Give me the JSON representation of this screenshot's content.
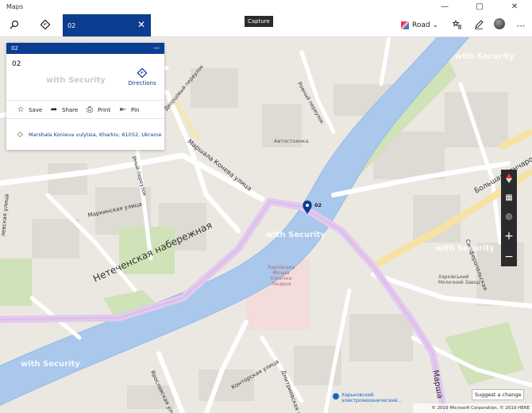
{
  "titlebar": {
    "app_title": "Maps",
    "minimize_icon": "minimize-icon",
    "maximize_icon": "maximize-icon",
    "close_icon": "close-icon"
  },
  "toolbar": {
    "search_icon": "search-icon",
    "directions_icon": "directions-icon",
    "search_value": "02",
    "clear_icon": "close-icon",
    "capture_tooltip": "Capture",
    "road_label": "Road",
    "accent_color": "#0b3d91"
  },
  "panel": {
    "header_title": "02",
    "title": "02",
    "directions_label": "Directions",
    "actions": [
      {
        "label": "Save",
        "icon": "star-icon"
      },
      {
        "label": "Share",
        "icon": "share-icon"
      },
      {
        "label": "Print",
        "icon": "print-icon"
      },
      {
        "label": "Pin",
        "icon": "pin-icon"
      }
    ],
    "address": "Marshala Konieva vulytsia, Kharkiv, 61052, Ukraine"
  },
  "map": {
    "pin_label": "02",
    "streets": {
      "naberezhnaya": "Нетеченская набережная",
      "koneva": "Маршала Конева улица",
      "marshala_right": "Марша",
      "markinskaya": "Маркинская улица",
      "kontorskaya": "Конторская улица",
      "dmitrievskaya": "Дмитриевская улица",
      "yaroslavskaya": "Ярославская улица",
      "bolshaya_goncharovka": "Большая Гончаро",
      "simferopolskaya": "Симферопольская",
      "rybny": "Рыбный переулок",
      "rybny_pereulok": "Ровный переулок",
      "left_ulitsa": "левская улица",
      "pereulok_mid": "рный переулок",
      "dvorcovy": "Дворцовый переулок"
    },
    "places": {
      "avtostoyanka": "Автостоянка",
      "hospital": "Харківська Міська Клінічна Лікарня",
      "zavod": "Харківський Молочний Завод",
      "elektro": "Харьковский электромеханический..."
    },
    "watermark": "with Security"
  },
  "map_controls": {
    "compass_icon": "compass-icon",
    "tilt_icon": "3d-buildings-icon",
    "locate_icon": "locate-icon",
    "zoom_in_icon": "plus-icon",
    "zoom_out_icon": "minus-icon"
  },
  "footer": {
    "suggest_change": "Suggest a change",
    "copyright": "© 2019 Microsoft Corporation, © 2019 HERE"
  }
}
